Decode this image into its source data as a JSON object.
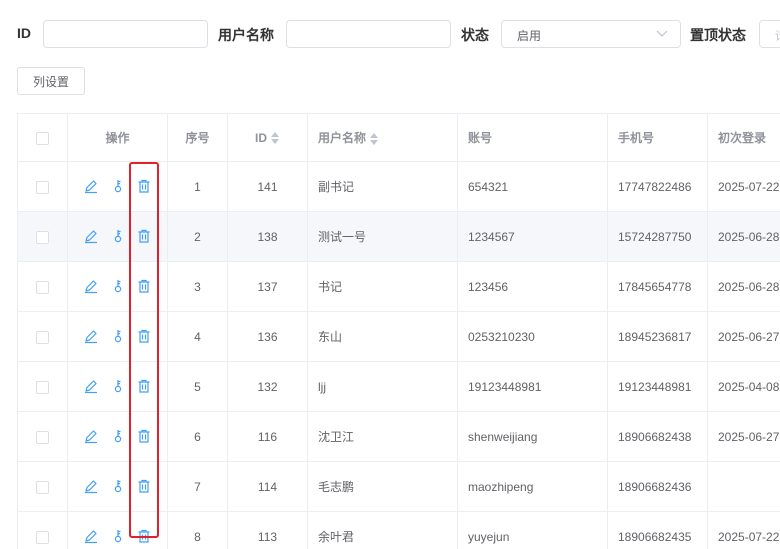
{
  "filters": {
    "id_label": "ID",
    "id_value": "",
    "username_label": "用户名称",
    "username_value": "",
    "status_label": "状态",
    "status_value": "启用",
    "pin_label": "置顶状态",
    "pin_placeholder": "请"
  },
  "toolbar": {
    "column_settings": "列设置"
  },
  "table": {
    "columns": {
      "actions": "操作",
      "index": "序号",
      "id": "ID",
      "username": "用户名称",
      "account": "账号",
      "phone": "手机号",
      "first_login": "初次登录"
    },
    "rows": [
      {
        "index": "1",
        "id": "141",
        "username": "副书记",
        "account": "654321",
        "phone": "17747822486",
        "first_login": "2025-07-22"
      },
      {
        "index": "2",
        "id": "138",
        "username": "测试一号",
        "account": "1234567",
        "phone": "15724287750",
        "first_login": "2025-06-28"
      },
      {
        "index": "3",
        "id": "137",
        "username": "书记",
        "account": "123456",
        "phone": "17845654778",
        "first_login": "2025-06-28"
      },
      {
        "index": "4",
        "id": "136",
        "username": "东山",
        "account": "0253210230",
        "phone": "18945236817",
        "first_login": "2025-06-27"
      },
      {
        "index": "5",
        "id": "132",
        "username": "ljj",
        "account": "19123448981",
        "phone": "19123448981",
        "first_login": "2025-04-08"
      },
      {
        "index": "6",
        "id": "116",
        "username": "沈卫江",
        "account": "shenweijiang",
        "phone": "18906682438",
        "first_login": "2025-06-27"
      },
      {
        "index": "7",
        "id": "114",
        "username": "毛志鹏",
        "account": "maozhipeng",
        "phone": "18906682436",
        "first_login": ""
      },
      {
        "index": "8",
        "id": "113",
        "username": "余叶君",
        "account": "yuyejun",
        "phone": "18906682435",
        "first_login": "2025-07-22"
      }
    ]
  },
  "icons": {
    "edit": "edit-icon",
    "key": "key-icon",
    "delete": "delete-icon",
    "chevron": "chevron-down-icon"
  },
  "colors": {
    "icon_blue": "#409eff",
    "highlight_red": "#e0202a",
    "header_text": "#909399"
  }
}
